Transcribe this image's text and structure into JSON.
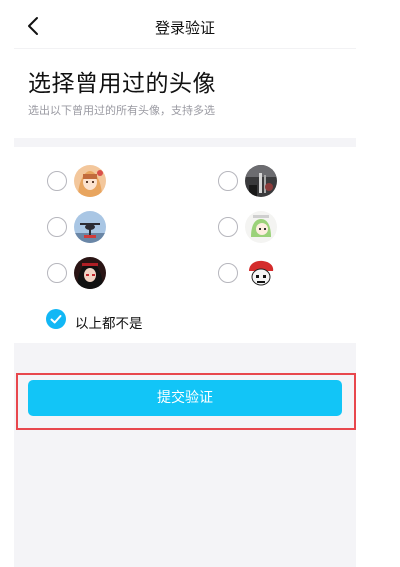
{
  "header": {
    "title": "登录验证",
    "back_icon": "chevron-left-icon"
  },
  "main": {
    "title": "选择曾用过的头像",
    "subtitle": "选出以下曾用过的所有头像，支持多选"
  },
  "avatars": [
    {
      "description": "avatar-anime-girl-blonde",
      "selected": false
    },
    {
      "description": "avatar-dark-portrait",
      "selected": false
    },
    {
      "description": "avatar-helicopter-scene",
      "selected": false
    },
    {
      "description": "avatar-green-hair-chibi",
      "selected": false
    },
    {
      "description": "avatar-red-dark-character",
      "selected": false
    },
    {
      "description": "avatar-red-hat-figure",
      "selected": false
    }
  ],
  "none_option": {
    "label": "以上都不是",
    "checked": true
  },
  "submit": {
    "label": "提交验证"
  },
  "colors": {
    "accent": "#12c5f7",
    "check": "#12b7f5",
    "highlight_border": "#e8474d",
    "panel_bg": "#f4f4f7"
  }
}
